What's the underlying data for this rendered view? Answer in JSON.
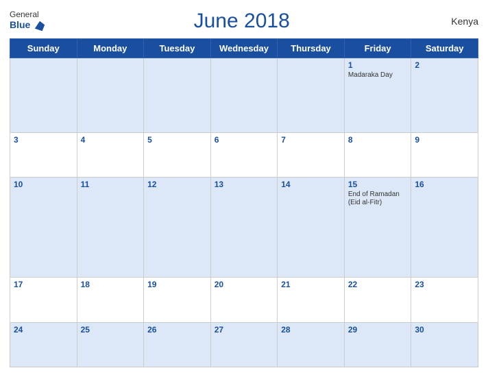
{
  "header": {
    "logo_general": "General",
    "logo_blue": "Blue",
    "title": "June 2018",
    "country": "Kenya"
  },
  "weekdays": [
    "Sunday",
    "Monday",
    "Tuesday",
    "Wednesday",
    "Thursday",
    "Friday",
    "Saturday"
  ],
  "weeks": [
    [
      {
        "day": "",
        "holiday": ""
      },
      {
        "day": "",
        "holiday": ""
      },
      {
        "day": "",
        "holiday": ""
      },
      {
        "day": "",
        "holiday": ""
      },
      {
        "day": "",
        "holiday": ""
      },
      {
        "day": "1",
        "holiday": "Madaraka Day"
      },
      {
        "day": "2",
        "holiday": ""
      }
    ],
    [
      {
        "day": "3",
        "holiday": ""
      },
      {
        "day": "4",
        "holiday": ""
      },
      {
        "day": "5",
        "holiday": ""
      },
      {
        "day": "6",
        "holiday": ""
      },
      {
        "day": "7",
        "holiday": ""
      },
      {
        "day": "8",
        "holiday": ""
      },
      {
        "day": "9",
        "holiday": ""
      }
    ],
    [
      {
        "day": "10",
        "holiday": ""
      },
      {
        "day": "11",
        "holiday": ""
      },
      {
        "day": "12",
        "holiday": ""
      },
      {
        "day": "13",
        "holiday": ""
      },
      {
        "day": "14",
        "holiday": ""
      },
      {
        "day": "15",
        "holiday": "End of Ramadan (Eid al-Fitr)"
      },
      {
        "day": "16",
        "holiday": ""
      }
    ],
    [
      {
        "day": "17",
        "holiday": ""
      },
      {
        "day": "18",
        "holiday": ""
      },
      {
        "day": "19",
        "holiday": ""
      },
      {
        "day": "20",
        "holiday": ""
      },
      {
        "day": "21",
        "holiday": ""
      },
      {
        "day": "22",
        "holiday": ""
      },
      {
        "day": "23",
        "holiday": ""
      }
    ],
    [
      {
        "day": "24",
        "holiday": ""
      },
      {
        "day": "25",
        "holiday": ""
      },
      {
        "day": "26",
        "holiday": ""
      },
      {
        "day": "27",
        "holiday": ""
      },
      {
        "day": "28",
        "holiday": ""
      },
      {
        "day": "29",
        "holiday": ""
      },
      {
        "day": "30",
        "holiday": ""
      }
    ]
  ],
  "colors": {
    "header_bg": "#1a4fa0",
    "odd_row_bg": "#dce8f8",
    "even_row_bg": "#ffffff",
    "day_number_color": "#1a4fa0"
  }
}
